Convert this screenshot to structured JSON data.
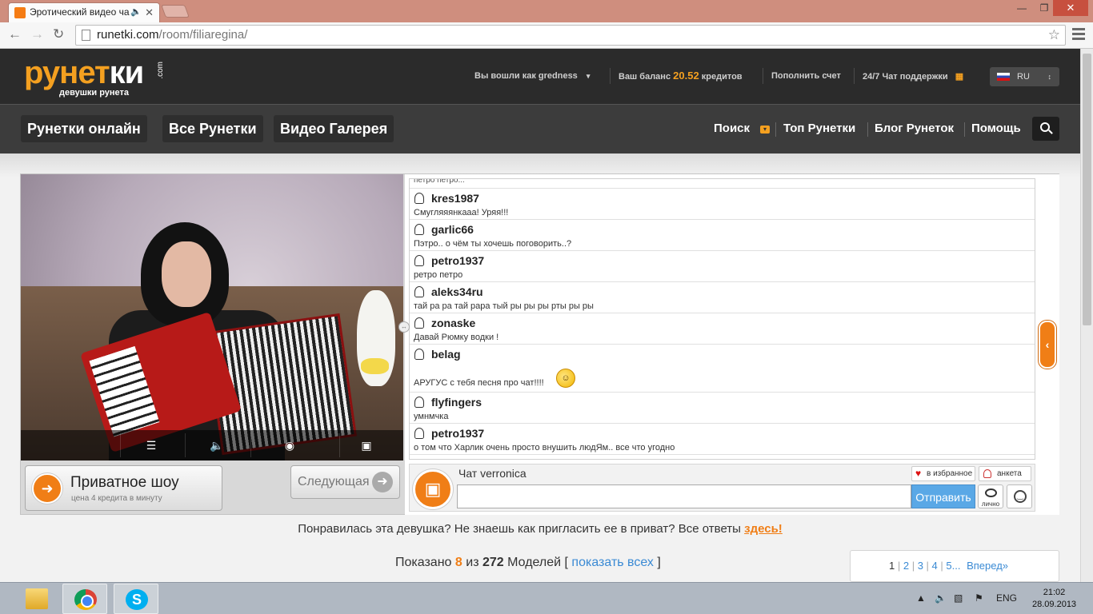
{
  "browser": {
    "tab_title": "Эротический видео ча",
    "url_domain": "runetki.com",
    "url_path": "/room/filiaregina/"
  },
  "site": {
    "logo_main": "рунет",
    "logo_bold": "ки",
    "logo_com": ".com",
    "logo_tagline": "девушки рунета",
    "user_label": "Вы вошли как gredness",
    "balance_label": "Ваш баланс",
    "balance_value": "20.52",
    "balance_unit": "кредитов",
    "topup": "Пополнить счет",
    "support": "24/7 Чат поддержки",
    "lang": "RU",
    "nav": {
      "online": "Рунетки онлайн",
      "all": "Все Рунетки",
      "gallery": "Видео Галерея",
      "search": "Поиск",
      "top": "Топ Рунетки",
      "blog": "Блог Рунеток",
      "help": "Помощь"
    }
  },
  "room": {
    "private_title": "Приватное шоу",
    "private_price": "цена 4 кредита в минуту",
    "next": "Следующая",
    "chat_title": "Чат verronica",
    "add_fav": "в избранное",
    "profile": "анкета",
    "send": "Отправить",
    "private_msg": "лично",
    "input_value": "",
    "partial_text": "петро петро...",
    "messages": [
      {
        "nick": "kres1987",
        "text": "Смугляяянкааа! Уряя!!!"
      },
      {
        "nick": "garlic66",
        "text": "Пэтро.. о чём ты хочешь поговорить..?"
      },
      {
        "nick": "petro1937",
        "text": "ретро петро"
      },
      {
        "nick": "aleks34ru",
        "text": "тай ра ра тай рара тый ры ры ры рты ры ры"
      },
      {
        "nick": "zonaske",
        "text": "Давай Рюмку водки !"
      },
      {
        "nick": "belag",
        "text": "АРУГУС с тебя песня про чат!!!!"
      },
      {
        "nick": "flyfingers",
        "text": "умнмчка"
      },
      {
        "nick": "petro1937",
        "text": "о том что Харлик очень просто внушить людЯм.. все что угодно"
      }
    ]
  },
  "footer": {
    "question": "Понравилась эта девушка? Не знаешь как пригласить ее в приват? Все ответы",
    "question_link": "здесь!",
    "shown_prefix": "Показано",
    "shown_count": "8",
    "shown_of": "из",
    "shown_total": "272",
    "shown_suffix": "Моделей [",
    "show_all": "показать всех",
    "shown_close": "]",
    "pages": [
      "1",
      "2",
      "3",
      "4",
      "5..."
    ],
    "next_page": "Вперед»"
  },
  "taskbar": {
    "lang": "ENG",
    "time": "21:02",
    "date": "28.09.2013"
  },
  "colors": {
    "accent": "#f07e16",
    "link": "#3a8ad4",
    "dark": "#2b2b2b"
  }
}
